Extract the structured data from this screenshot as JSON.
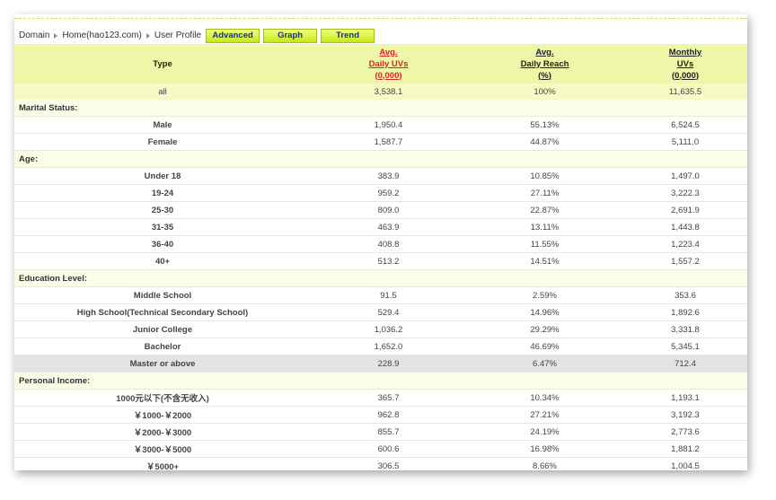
{
  "breadcrumb": {
    "items": [
      "Domain",
      "Home(hao123.com)",
      "User Profile"
    ]
  },
  "tabs": [
    "Advanced",
    "Graph",
    "Trend"
  ],
  "header": {
    "type": "Type",
    "col2": [
      "Avg.",
      "Daily UVs",
      "(0,000)"
    ],
    "col3": [
      "Avg.",
      "Daily Reach",
      "(%)"
    ],
    "col4": [
      "Monthly",
      "UVs",
      "(0,000)"
    ]
  },
  "all_row": {
    "type": "all",
    "daily_uvs": "3,538.1",
    "daily_reach": "100%",
    "monthly_uvs": "11,635.5"
  },
  "sections": [
    {
      "title": "Marital Status:",
      "rows": [
        {
          "type": "Male",
          "daily_uvs": "1,950.4",
          "daily_reach": "55.13%",
          "monthly_uvs": "6,524.5"
        },
        {
          "type": "Female",
          "daily_uvs": "1,587.7",
          "daily_reach": "44.87%",
          "monthly_uvs": "5,111.0"
        }
      ]
    },
    {
      "title": "Age:",
      "rows": [
        {
          "type": "Under 18",
          "daily_uvs": "383.9",
          "daily_reach": "10.85%",
          "monthly_uvs": "1,497.0"
        },
        {
          "type": "19-24",
          "daily_uvs": "959.2",
          "daily_reach": "27.11%",
          "monthly_uvs": "3,222.3"
        },
        {
          "type": "25-30",
          "daily_uvs": "809.0",
          "daily_reach": "22.87%",
          "monthly_uvs": "2,691.9"
        },
        {
          "type": "31-35",
          "daily_uvs": "463.9",
          "daily_reach": "13.11%",
          "monthly_uvs": "1,443.8"
        },
        {
          "type": "36-40",
          "daily_uvs": "408.8",
          "daily_reach": "11.55%",
          "monthly_uvs": "1,223.4"
        },
        {
          "type": "40+",
          "daily_uvs": "513.2",
          "daily_reach": "14.51%",
          "monthly_uvs": "1,557.2"
        }
      ]
    },
    {
      "title": "Education Level:",
      "rows": [
        {
          "type": "Middle School",
          "daily_uvs": "91.5",
          "daily_reach": "2.59%",
          "monthly_uvs": "353.6"
        },
        {
          "type": "High School(Technical Secondary School)",
          "daily_uvs": "529.4",
          "daily_reach": "14.96%",
          "monthly_uvs": "1,892.6"
        },
        {
          "type": "Junior College",
          "daily_uvs": "1,036.2",
          "daily_reach": "29.29%",
          "monthly_uvs": "3,331.8"
        },
        {
          "type": "Bachelor",
          "daily_uvs": "1,652.0",
          "daily_reach": "46.69%",
          "monthly_uvs": "5,345.1"
        },
        {
          "type": "Master or above",
          "daily_uvs": "228.9",
          "daily_reach": "6.47%",
          "monthly_uvs": "712.4",
          "highlighted": true
        }
      ]
    },
    {
      "title": "Personal Income:",
      "rows": [
        {
          "type": "1000元以下(不含无收入)",
          "daily_uvs": "365.7",
          "daily_reach": "10.34%",
          "monthly_uvs": "1,193.1"
        },
        {
          "type": "￥1000-￥2000",
          "daily_uvs": "962.8",
          "daily_reach": "27.21%",
          "monthly_uvs": "3,192.3"
        },
        {
          "type": "￥2000-￥3000",
          "daily_uvs": "855.7",
          "daily_reach": "24.19%",
          "monthly_uvs": "2,773.6"
        },
        {
          "type": "￥3000-￥5000",
          "daily_uvs": "600.6",
          "daily_reach": "16.98%",
          "monthly_uvs": "1,881.2"
        },
        {
          "type": "￥5000+",
          "daily_uvs": "306.5",
          "daily_reach": "8.66%",
          "monthly_uvs": "1,004.5"
        }
      ]
    }
  ],
  "colors": {
    "header_bg": "#eef7a7",
    "tab_bg": "#c6e81c",
    "tab_text": "#10338a",
    "sort_red": "#dd2222"
  }
}
